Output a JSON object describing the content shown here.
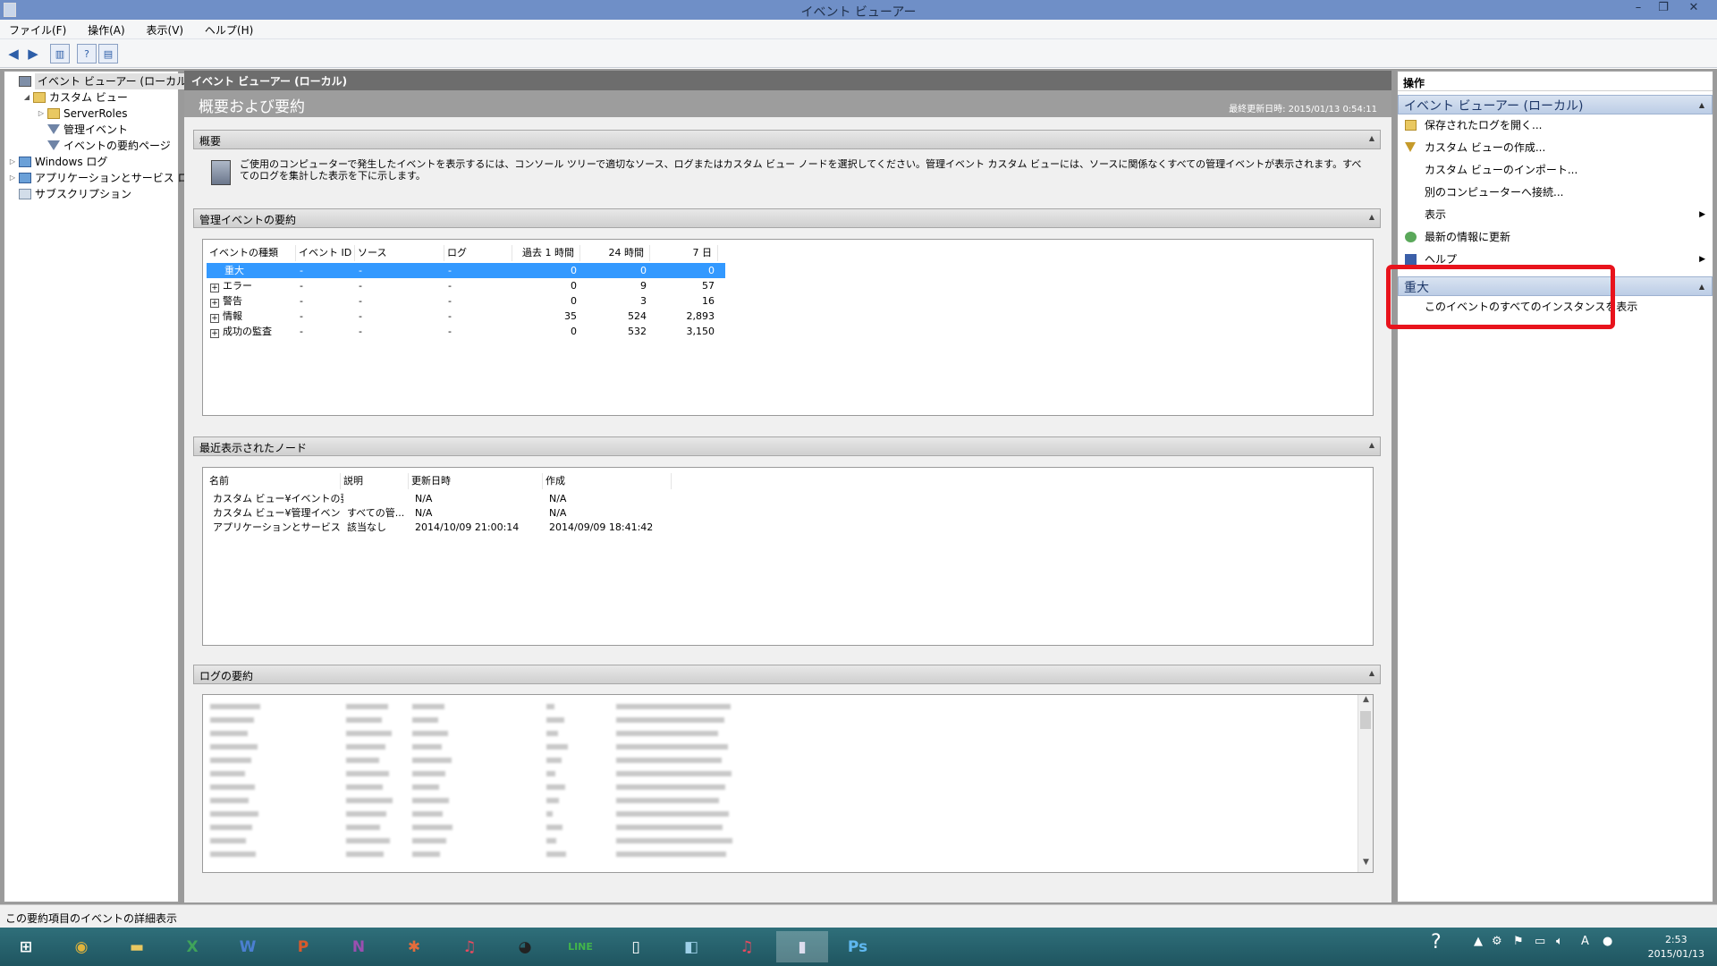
{
  "window": {
    "title": "イベント ビューアー"
  },
  "menu": [
    "ファイル(F)",
    "操作(A)",
    "表示(V)",
    "ヘルプ(H)"
  ],
  "tree": {
    "items": [
      {
        "label": "イベント ビューアー (ローカル)",
        "level": 0,
        "expander": "",
        "icon": "event-viewer-icon",
        "selected": true
      },
      {
        "label": "カスタム ビュー",
        "level": 1,
        "expander": "◢",
        "icon": "folder-icon"
      },
      {
        "label": "ServerRoles",
        "level": 2,
        "expander": "▷",
        "icon": "folder-icon"
      },
      {
        "label": "管理イベント",
        "level": 2,
        "expander": "",
        "icon": "filter-icon"
      },
      {
        "label": "イベントの要約ページ",
        "level": 2,
        "expander": "",
        "icon": "filter-icon"
      },
      {
        "label": "Windows ログ",
        "level": 0,
        "expander": "▷",
        "icon": "log-icon"
      },
      {
        "label": "アプリケーションとサービス ログ",
        "level": 0,
        "expander": "▷",
        "icon": "log-icon"
      },
      {
        "label": "サブスクリプション",
        "level": 0,
        "expander": "",
        "icon": "subscription-icon"
      }
    ]
  },
  "center": {
    "header": "イベント ビューアー (ローカル)",
    "subtitle": "概要および要約",
    "last_updated": "最終更新日時: 2015/01/13 0:54:11",
    "overview": {
      "title": "概要",
      "text": "ご使用のコンピューターで発生したイベントを表示するには、コンソール ツリーで適切なソース、ログまたはカスタム ビュー ノードを選択してください。管理イベント カスタム ビューには、ソースに関係なくすべての管理イベントが表示されます。すべてのログを集計した表示を下に示します。"
    },
    "admin_summary": {
      "title": "管理イベントの要約",
      "columns": [
        "イベントの種類",
        "イベント ID",
        "ソース",
        "ログ",
        "過去 1 時間",
        "24 時間",
        "7 日"
      ],
      "rows": [
        {
          "type": "重大",
          "id": "-",
          "source": "-",
          "log": "-",
          "h1": "0",
          "h24": "0",
          "d7": "0",
          "expandable": false,
          "selected": true
        },
        {
          "type": "エラー",
          "id": "-",
          "source": "-",
          "log": "-",
          "h1": "0",
          "h24": "9",
          "d7": "57",
          "expandable": true
        },
        {
          "type": "警告",
          "id": "-",
          "source": "-",
          "log": "-",
          "h1": "0",
          "h24": "3",
          "d7": "16",
          "expandable": true
        },
        {
          "type": "情報",
          "id": "-",
          "source": "-",
          "log": "-",
          "h1": "35",
          "h24": "524",
          "d7": "2,893",
          "expandable": true
        },
        {
          "type": "成功の監査",
          "id": "-",
          "source": "-",
          "log": "-",
          "h1": "0",
          "h24": "532",
          "d7": "3,150",
          "expandable": true
        }
      ]
    },
    "recent_nodes": {
      "title": "最近表示されたノード",
      "columns": [
        "名前",
        "説明",
        "更新日時",
        "作成"
      ],
      "rows": [
        {
          "name": "カスタム ビュー¥イベントの要...",
          "desc": "",
          "modified": "N/A",
          "created": "N/A"
        },
        {
          "name": "カスタム ビュー¥管理イベント",
          "desc": "すべての管...",
          "modified": "N/A",
          "created": "N/A"
        },
        {
          "name": "アプリケーションとサービス ログ...",
          "desc": "該当なし",
          "modified": "2014/10/09 21:00:14",
          "created": "2014/09/09 18:41:42"
        }
      ]
    },
    "log_summary": {
      "title": "ログの要約"
    }
  },
  "actions": {
    "title": "操作",
    "section1": "イベント ビューアー (ローカル)",
    "items1": [
      {
        "label": "保存されたログを開く...",
        "icon": "open-log-icon",
        "submenu": false
      },
      {
        "label": "カスタム ビューの作成...",
        "icon": "filter-create-icon",
        "submenu": false
      },
      {
        "label": "カスタム ビューのインポート...",
        "icon": "",
        "submenu": false
      },
      {
        "label": "別のコンピューターへ接続...",
        "icon": "",
        "submenu": false
      },
      {
        "label": "表示",
        "icon": "",
        "submenu": true
      },
      {
        "label": "最新の情報に更新",
        "icon": "refresh-icon",
        "submenu": false
      },
      {
        "label": "ヘルプ",
        "icon": "help-icon",
        "submenu": true
      }
    ],
    "section2": "重大",
    "items2": [
      {
        "label": "このイベントのすべてのインスタンスを表示"
      }
    ]
  },
  "status": "この要約項目のイベントの詳細表示",
  "taskbar": {
    "apps": [
      "start-icon",
      "chrome-icon",
      "explorer-icon",
      "excel-icon",
      "word-icon",
      "powerpoint-icon",
      "onenote-icon",
      "photos-icon",
      "itunes-icon",
      "owl-app-icon",
      "line-icon",
      "reader-icon",
      "notes-icon",
      "itunes2-icon",
      "event-viewer-task-icon",
      "photoshop-icon"
    ],
    "app_labels": {
      "excel": "X",
      "word": "W",
      "powerpoint": "P",
      "onenote": "N",
      "line": "LINE",
      "photoshop": "Ps"
    },
    "time": "2:53",
    "date": "2015/01/13"
  }
}
